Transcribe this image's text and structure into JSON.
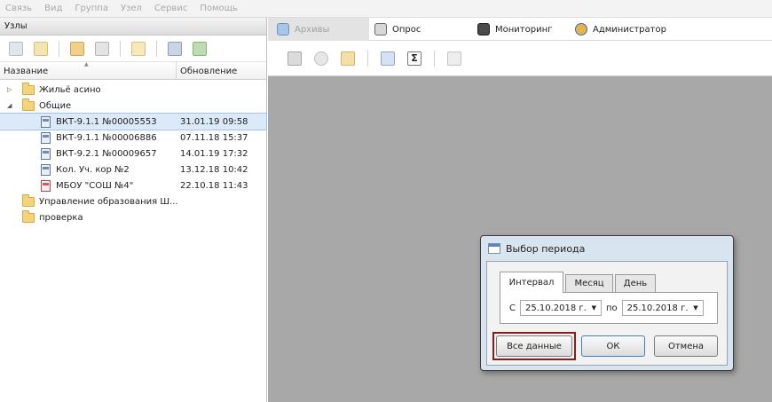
{
  "menu": [
    "Связь",
    "Вид",
    "Группа",
    "Узел",
    "Сервис",
    "Помощь"
  ],
  "left_panel": {
    "title": "Узлы",
    "columns": {
      "name": "Название",
      "updated": "Обновление"
    },
    "tree": [
      {
        "label": "Жильё асино",
        "type": "folder",
        "level": 0,
        "expander": "▷"
      },
      {
        "label": "Общие",
        "type": "folder",
        "level": 0,
        "expander": "◢"
      },
      {
        "label": "ВКТ-9.1.1 №00005553",
        "type": "device",
        "level": 1,
        "updated": "31.01.19 09:58",
        "selected": true
      },
      {
        "label": "ВКТ-9.1.1 №00006886",
        "type": "device",
        "level": 1,
        "updated": "07.11.18 15:37"
      },
      {
        "label": "ВКТ-9.2.1 №00009657",
        "type": "device",
        "level": 1,
        "updated": "14.01.19 17:32"
      },
      {
        "label": "Кол. Уч. кор №2",
        "type": "device",
        "level": 1,
        "updated": "13.12.18 10:42"
      },
      {
        "label": "МБОУ \"СОШ №4\"",
        "type": "device-red",
        "level": 1,
        "updated": "22.10.18 11:43"
      },
      {
        "label": "Управление образования Ш...",
        "type": "folder",
        "level": 0
      },
      {
        "label": "проверка",
        "type": "folder",
        "level": 0
      }
    ]
  },
  "tabs": [
    {
      "label": "Архивы",
      "icon": "archive-icon",
      "active": true
    },
    {
      "label": "Опрос",
      "icon": "poll-icon"
    },
    {
      "label": "Мониторинг",
      "icon": "monitor-icon"
    },
    {
      "label": "Администратор",
      "icon": "admin-icon"
    }
  ],
  "toolbar_icons": [
    "read-archive-icon",
    "settings-icon",
    "report-icon",
    "copy-icon",
    "sum-icon",
    "document-icon"
  ],
  "sum_symbol": "Σ",
  "dialog": {
    "title": "Выбор периода",
    "tabs": [
      "Интервал",
      "Месяц",
      "День"
    ],
    "from_label": "С",
    "from_value": "25.10.2018 г.",
    "to_label": "по",
    "to_value": "25.10.2018 г.",
    "buttons": {
      "all_data": "Все данные",
      "ok": "ОК",
      "cancel": "Отмена"
    }
  },
  "colors": {
    "highlight": "#8b1a1a",
    "workspace": "#a8a8a8",
    "dialog_frame": "#d9e4f1",
    "selection": "#dbe9f8"
  }
}
